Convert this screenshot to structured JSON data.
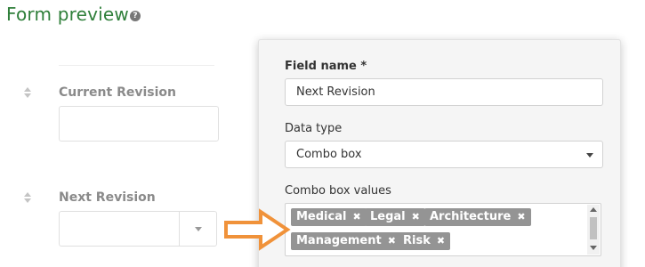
{
  "page": {
    "title": "Form preview",
    "help_icon": "question-circle-icon"
  },
  "form_fields": [
    {
      "label": "Current Revision",
      "type": "text",
      "value": ""
    },
    {
      "label": "Next Revision",
      "type": "combo",
      "value": ""
    }
  ],
  "editor": {
    "field_name_label": "Field name *",
    "field_name_value": "Next Revision",
    "data_type_label": "Data type",
    "data_type_value": "Combo box",
    "combo_values_label": "Combo box values",
    "combo_values": [
      "Medical",
      "Legal",
      "Architecture",
      "Management",
      "Risk"
    ],
    "remove_symbol": "✖"
  },
  "colors": {
    "title": "#2f7f3a",
    "tag_background": "#949494",
    "annotation_arrow": "#f0923a"
  }
}
